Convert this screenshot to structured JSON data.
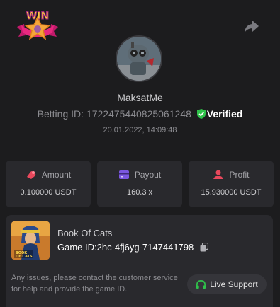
{
  "header": {
    "badge_text": "WIN",
    "badge_icon": "star-ribbon-icon",
    "share_icon": "share-icon"
  },
  "profile": {
    "username": "MaksatMe",
    "betting_id_label": "Betting ID:",
    "betting_id": "1722475440825061248",
    "verified_label": "Verified",
    "datetime": "20.01.2022, 14:09:48"
  },
  "stats": [
    {
      "label": "Amount",
      "value": "0.100000 USDT",
      "icon": "amount-icon",
      "color": "#e8485c"
    },
    {
      "label": "Payout",
      "value": "160.3 x",
      "icon": "payout-card-icon",
      "color": "#7b57e0"
    },
    {
      "label": "Profit",
      "value": "15.930000 USDT",
      "icon": "profit-icon",
      "color": "#e8485c"
    }
  ],
  "game": {
    "name": "Book Of Cats",
    "id_label": "Game ID:",
    "id": "2hc-4fj6yg-7147441798",
    "thumb_text": "BOOK OF CATS"
  },
  "support": {
    "help_text": "Any issues, please contact the customer service for help and provide the game ID.",
    "button_label": "Live Support"
  },
  "colors": {
    "background": "#1c1c1e",
    "card": "#29292d",
    "verified": "#2fc24a",
    "support_icon": "#2fc24a"
  }
}
